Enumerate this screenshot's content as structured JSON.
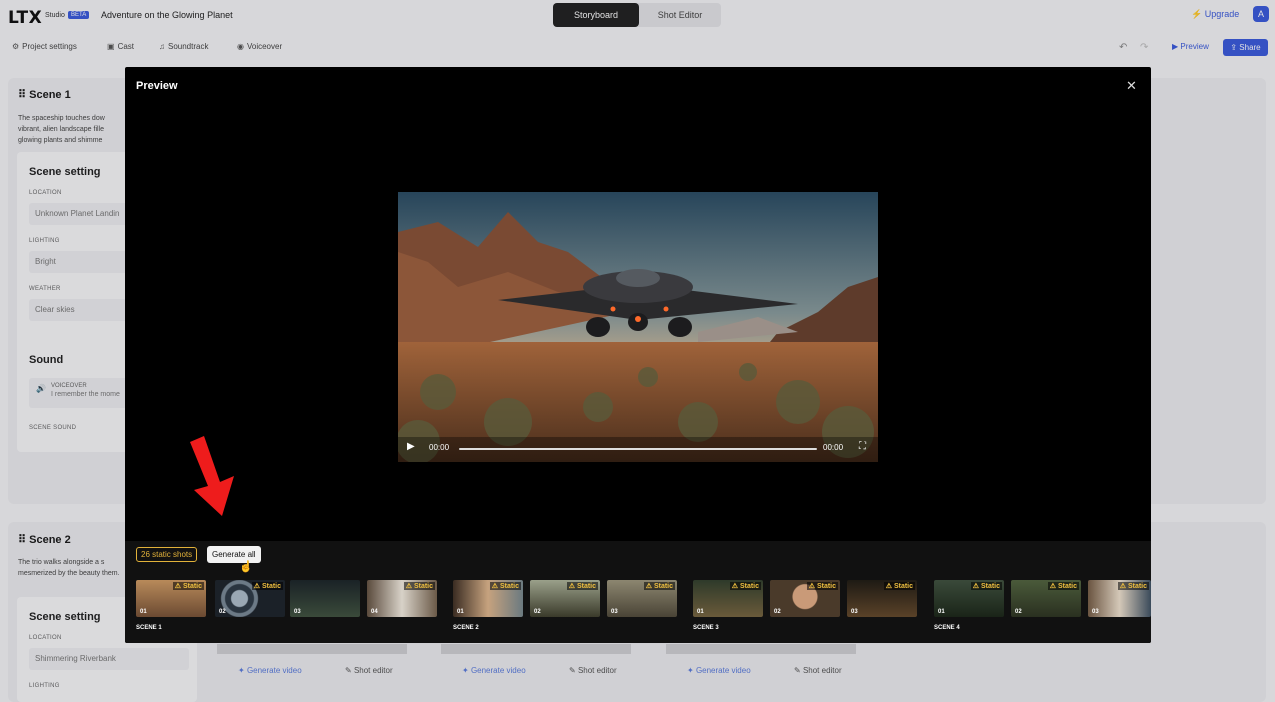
{
  "app": {
    "logo": "LTX",
    "logo_sub": "Studio",
    "beta": "BETA",
    "project_title": "Adventure on the Glowing Planet",
    "modes": [
      "Storyboard",
      "Shot Editor"
    ],
    "upgrade": "Upgrade",
    "avatar_initial": "A",
    "accent": "#3b5bdb"
  },
  "subbar": {
    "items": [
      {
        "icon": "gear-icon",
        "label": "Project settings"
      },
      {
        "icon": "cast-icon",
        "label": "Cast"
      },
      {
        "icon": "music-icon",
        "label": "Soundtrack"
      },
      {
        "icon": "voiceover-icon",
        "label": "Voiceover"
      }
    ],
    "preview": "Preview",
    "share": "Share"
  },
  "scene1": {
    "title": "Scene 1",
    "desc": "The spaceship touches dow vibrant, alien landscape fille glowing plants and shimme",
    "setting_title": "Scene setting",
    "location_label": "LOCATION",
    "location_value": "Unknown Planet Landin",
    "lighting_label": "LIGHTING",
    "lighting_value": "Bright",
    "weather_label": "WEATHER",
    "weather_value": "Clear skies",
    "sound_title": "Sound",
    "voiceover_label": "VOICEOVER",
    "voiceover_value": "I remember the mome",
    "scene_sound_label": "SCENE SOUND"
  },
  "scene2": {
    "title": "Scene 2",
    "desc": "The trio walks alongside a s mesmerized by the beauty them.",
    "setting_title": "Scene setting",
    "location_label": "LOCATION",
    "location_value": "Shimmering Riverbank",
    "lighting_label": "LIGHTING"
  },
  "bottom_actions": {
    "generate_video": "Generate video",
    "shot_editor": "Shot editor"
  },
  "modal": {
    "title": "Preview",
    "time_current": "00:00",
    "time_total": "00:00",
    "static_shots": "26 static shots",
    "generate_all": "Generate all",
    "static_label": "Static",
    "scenes": [
      {
        "label": "SCENE 1",
        "shots": [
          "01",
          "02",
          "03",
          "04"
        ]
      },
      {
        "label": "SCENE 2",
        "shots": [
          "01",
          "02",
          "03"
        ]
      },
      {
        "label": "SCENE 3",
        "shots": [
          "01",
          "02",
          "03"
        ]
      },
      {
        "label": "SCENE 4",
        "shots": [
          "01",
          "02",
          "03"
        ]
      }
    ]
  }
}
